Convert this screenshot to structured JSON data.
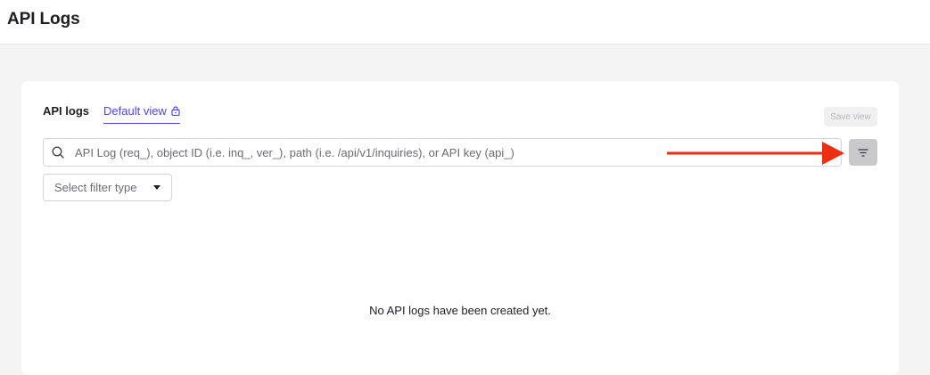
{
  "header": {
    "title": "API Logs"
  },
  "tabs": [
    {
      "label": "API logs",
      "active": false
    },
    {
      "label": "Default view",
      "active": true,
      "icon": "lock-icon"
    }
  ],
  "toolbar": {
    "save_view_label": "Save view",
    "filter_icon": "filter-lines-icon"
  },
  "search": {
    "placeholder": "API Log (req_), object ID (i.e. inq_, ver_), path (i.e. /api/v1/inquiries), or API key (api_)",
    "value": ""
  },
  "filter_type": {
    "selected": "Select filter type"
  },
  "empty_state": {
    "message": "No API logs have been created yet."
  },
  "annotation": {
    "arrow_color": "#ee2e10",
    "target": "filter-button"
  },
  "colors": {
    "accent": "#4f46e5",
    "background": "#f4f4f5"
  }
}
